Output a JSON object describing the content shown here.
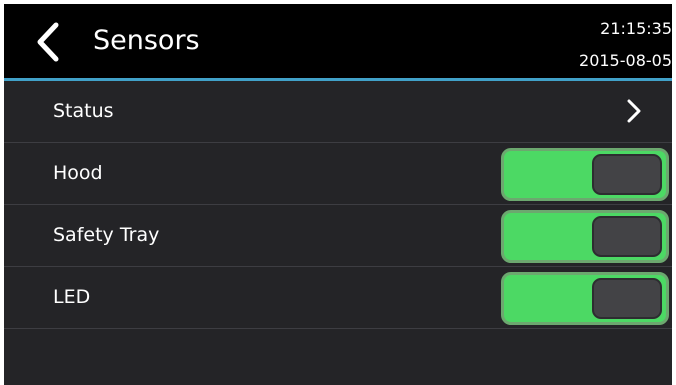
{
  "header": {
    "title": "Sensors",
    "time": "21:15:35",
    "date": "2015-08-05",
    "back_icon": "chevron-left-icon",
    "accent_color": "#41a1c9"
  },
  "list": {
    "status": {
      "label": "Status",
      "icon": "chevron-right-icon"
    },
    "hood": {
      "label": "Hood",
      "toggle_color": "#4cd964"
    },
    "safety_tray": {
      "label": "Safety Tray",
      "toggle_color": "#4cd964"
    },
    "led": {
      "label": "LED",
      "toggle_color": "#4cd964"
    }
  }
}
